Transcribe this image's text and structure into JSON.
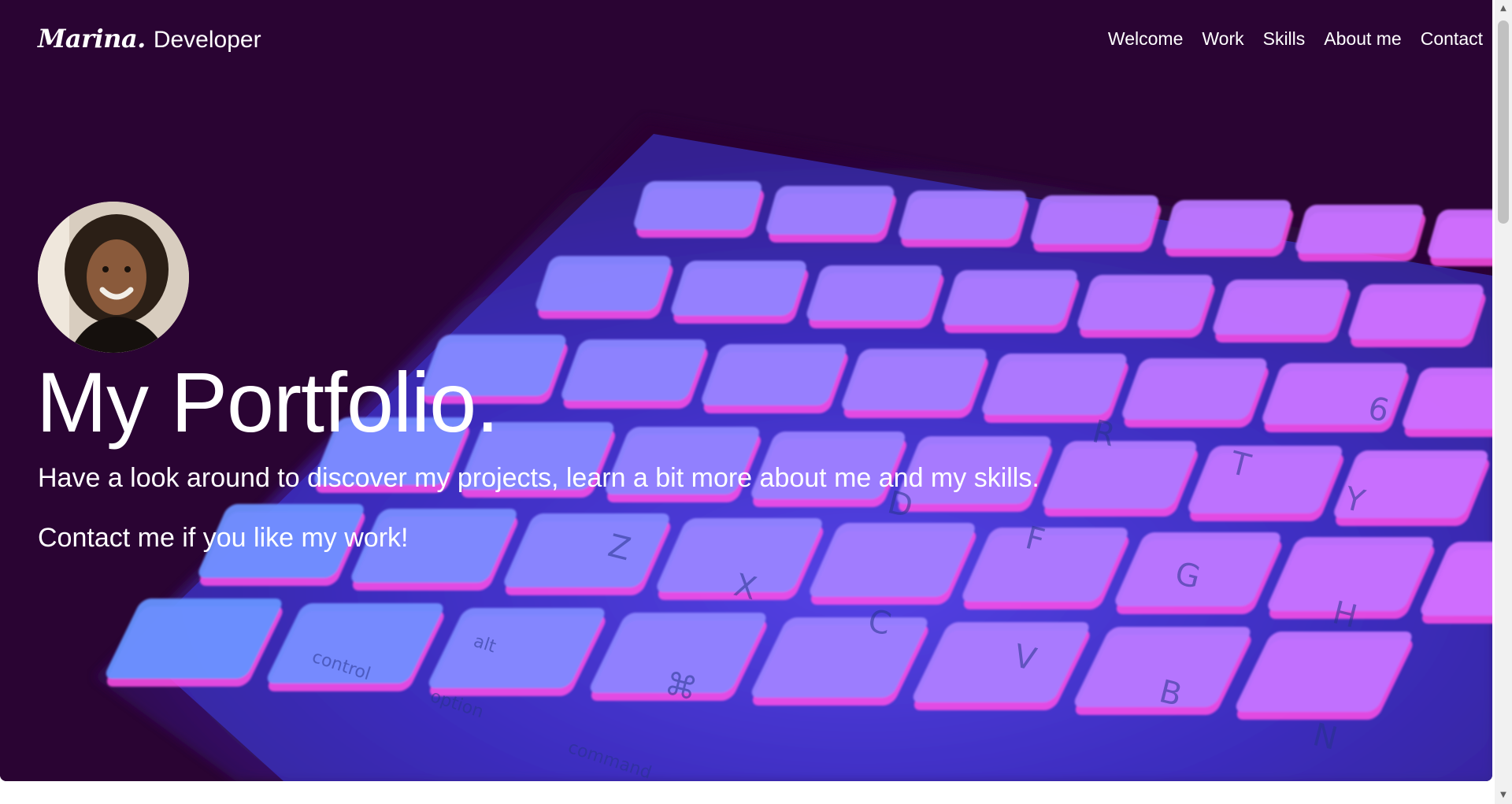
{
  "brand": {
    "name": "Marina.",
    "role": "Developer"
  },
  "nav": {
    "items": [
      "Welcome",
      "Work",
      "Skills",
      "About me",
      "Contact"
    ]
  },
  "hero": {
    "title": "My Portfolio.",
    "line1": "Have a look around to discover my projects, learn a bit more about me and my skills.",
    "line2": "Contact me if you like my work!"
  },
  "keyboard_labels": [
    "R",
    "T",
    "Y",
    "D",
    "F",
    "G",
    "H",
    "Z",
    "X",
    "C",
    "V",
    "B",
    "N",
    "6",
    "⌘",
    "alt",
    "option",
    "command",
    "control"
  ],
  "colors": {
    "background": "#2a0433",
    "text": "#ffffff",
    "key_blue": "#5f7bff",
    "key_pink": "#ff5ff0"
  },
  "scrollbar": {
    "up_icon": "▲",
    "down_icon": "▼"
  }
}
